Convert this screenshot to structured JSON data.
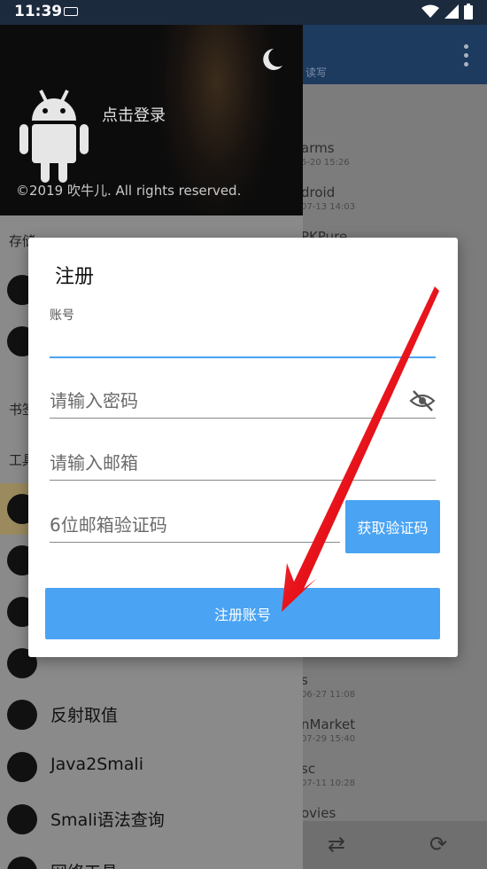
{
  "status_bar": {
    "time": "11:39"
  },
  "background": {
    "toolbar_sub": "读写",
    "rows": [
      {
        "title": "arms",
        "date": "5-20 15:26"
      },
      {
        "title": "droid",
        "date": "07-13 14:03"
      },
      {
        "title": "PKPure",
        "date": ""
      },
      {
        "title": "s",
        "date": "06-27 11:08"
      },
      {
        "title": "nMarket",
        "date": "07-29 15:40"
      },
      {
        "title": "sc",
        "date": "07-11 10:28"
      },
      {
        "title": "ovies",
        "date": ""
      }
    ]
  },
  "drawer": {
    "login_text": "点击登录",
    "copyright": "©2019 吹牛儿. All rights reserved.",
    "sections": {
      "storage": "存储",
      "bookmarks": "书签",
      "tools": "工具"
    },
    "items": [
      {
        "label": "反射取值",
        "icon": "reflect-icon"
      },
      {
        "label": "Java2Smali",
        "icon": "java-icon"
      },
      {
        "label": "Smali语法查询",
        "icon": "smali-icon"
      },
      {
        "label": "网络工具",
        "icon": "globe-icon"
      }
    ]
  },
  "dialog": {
    "title": "注册",
    "account_label": "账号",
    "account_value": "",
    "password_placeholder": "请输入密码",
    "email_placeholder": "请输入邮箱",
    "code_placeholder": "6位邮箱验证码",
    "get_code_label": "获取验证码",
    "register_label": "注册账号"
  },
  "colors": {
    "accent": "#4aa3f3",
    "arrow": "#e8131b"
  }
}
